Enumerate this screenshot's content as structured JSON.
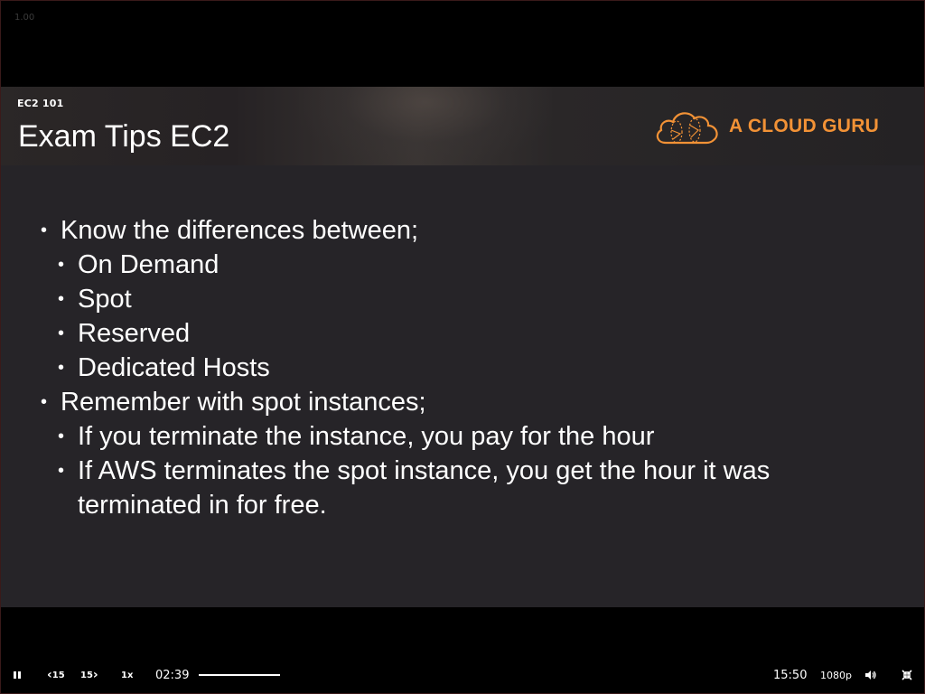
{
  "overlay": {
    "speed_ghost": "1.00"
  },
  "slide": {
    "course_label": "EC2 101",
    "title": "Exam Tips EC2",
    "logo_text": "A CLOUD GURU",
    "accent_color": "#f29236",
    "bullets": [
      {
        "level": 1,
        "text": "Know the differences between;"
      },
      {
        "level": 2,
        "text": "On Demand"
      },
      {
        "level": 2,
        "text": "Spot"
      },
      {
        "level": 2,
        "text": "Reserved"
      },
      {
        "level": 2,
        "text": "Dedicated Hosts"
      },
      {
        "level": 1,
        "text": "Remember with spot instances;"
      },
      {
        "level": 2,
        "text": "If you terminate the instance, you pay for the hour"
      },
      {
        "level": 2,
        "text": "If AWS terminates the spot instance, you get the hour it was"
      },
      {
        "level": 3,
        "text": "terminated in for free."
      }
    ]
  },
  "player": {
    "play_pause_icon": "pause-icon",
    "rewind_label": "15",
    "forward_label": "15",
    "speed_label": "1x",
    "current_time": "02:39",
    "duration": "15:50",
    "quality_label": "1080p",
    "volume_icon": "volume-icon",
    "fullscreen_icon": "exit-fullscreen-icon"
  }
}
